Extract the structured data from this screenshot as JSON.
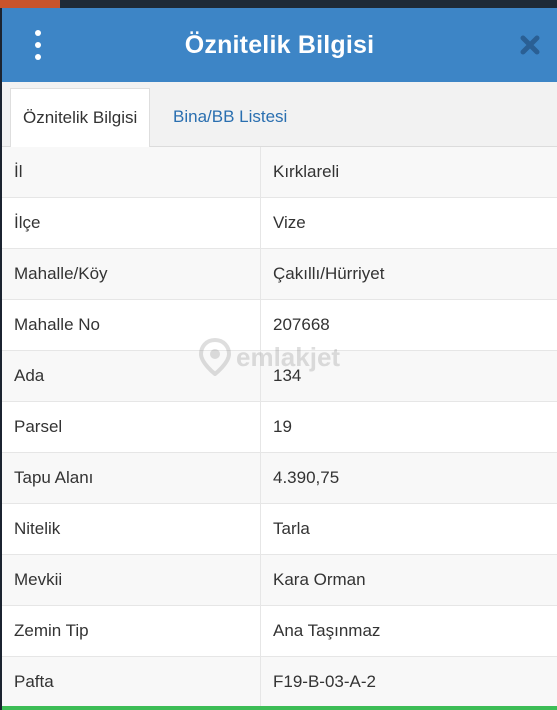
{
  "header": {
    "title": "Öznitelik Bilgisi",
    "menu_icon": "more-vertical-icon",
    "close_icon": "close-icon"
  },
  "tabs": [
    {
      "label": "Öznitelik Bilgisi",
      "active": true
    },
    {
      "label": "Bina/BB Listesi",
      "active": false
    }
  ],
  "rows": [
    {
      "key": "İl",
      "value": "Kırklareli"
    },
    {
      "key": "İlçe",
      "value": "Vize"
    },
    {
      "key": "Mahalle/Köy",
      "value": "Çakıllı/Hürriyet"
    },
    {
      "key": "Mahalle No",
      "value": "207668"
    },
    {
      "key": "Ada",
      "value": "134"
    },
    {
      "key": "Parsel",
      "value": "19"
    },
    {
      "key": "Tapu Alanı",
      "value": "4.390,75"
    },
    {
      "key": "Nitelik",
      "value": "Tarla"
    },
    {
      "key": "Mevkii",
      "value": "Kara Orman"
    },
    {
      "key": "Zemin Tip",
      "value": "Ana Taşınmaz"
    },
    {
      "key": "Pafta",
      "value": "F19-B-03-A-2"
    }
  ],
  "watermark": {
    "text": "emlakjet"
  },
  "colors": {
    "header": "#3d85c6",
    "tab_link": "#2a6fb0",
    "accent_bottom": "#3dbd56"
  }
}
